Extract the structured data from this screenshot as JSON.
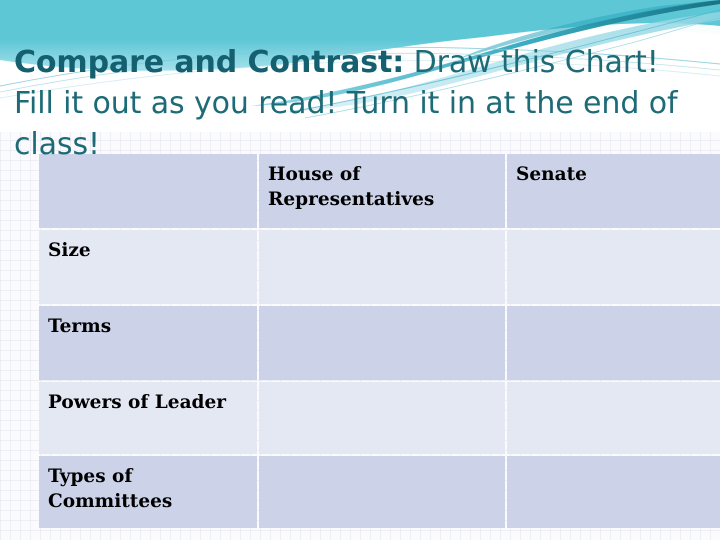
{
  "slide": {
    "title_strong": "Compare and Contrast:",
    "title_rest": " Draw this Chart! Fill it out as you read! Turn it in at the end of class!",
    "title_color": "#1d6b77"
  },
  "theme": {
    "banner_teal": "#2aa8bd",
    "banner_teal_dark": "#17808f",
    "banner_aqua": "#9fdce8",
    "banner_white": "#ffffff",
    "table_header_fill": "#ccd3e8",
    "table_row_light": "#e4e8f3",
    "table_row_dark": "#ccd3e8",
    "table_text": "#000000"
  },
  "table": {
    "columns": [
      "",
      "House of Representatives",
      "Senate"
    ],
    "rows": [
      {
        "label": "Size",
        "house": "",
        "senate": ""
      },
      {
        "label": "Terms",
        "house": "",
        "senate": ""
      },
      {
        "label": "Powers of Leader",
        "house": "",
        "senate": ""
      },
      {
        "label": "Types of Committees",
        "house": "",
        "senate": ""
      }
    ]
  }
}
